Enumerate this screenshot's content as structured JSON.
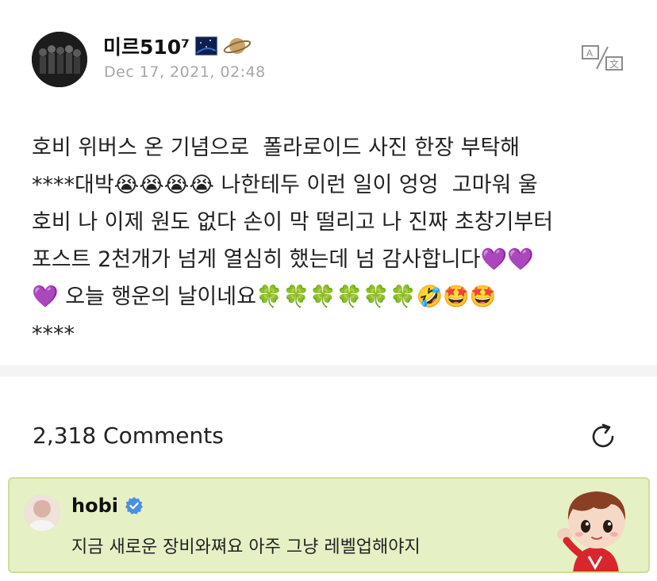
{
  "post": {
    "author": "미르510⁷",
    "date": "Dec 17, 2021, 02:48",
    "body": "호비 위버스 온 기념으로  폴라로이드 사진 한장 부탁해\n****대박😭😭😭😭 나한테두 이런 일이 엉엉  고마워 울\n호비 나 이제 원도 없다 손이 막 떨리고 나 진짜 초창기부터\n포스트 2천개가 넘게 열심히 했는데 넘 감사합니다💜💜\n💜 오늘 행운의 날이네요🍀🍀🍀🍀🍀🍀🤣🤩🤩\n****",
    "translate_icon": "translate-icon"
  },
  "comments": {
    "count_label": "2,318 Comments",
    "refresh_icon": "refresh-icon"
  },
  "artist_comment": {
    "author": "hobi",
    "verified_icon": "verified-badge-icon",
    "text": "지금 새로운 장비와쪄요 아주 그냥 레벨업해야지"
  },
  "colors": {
    "date": "#a7a7a7",
    "separator": "#f4f4f6",
    "artist_bg": "#e5f0c4",
    "artist_border": "#ccdf9a",
    "verified": "#4a90e2"
  }
}
